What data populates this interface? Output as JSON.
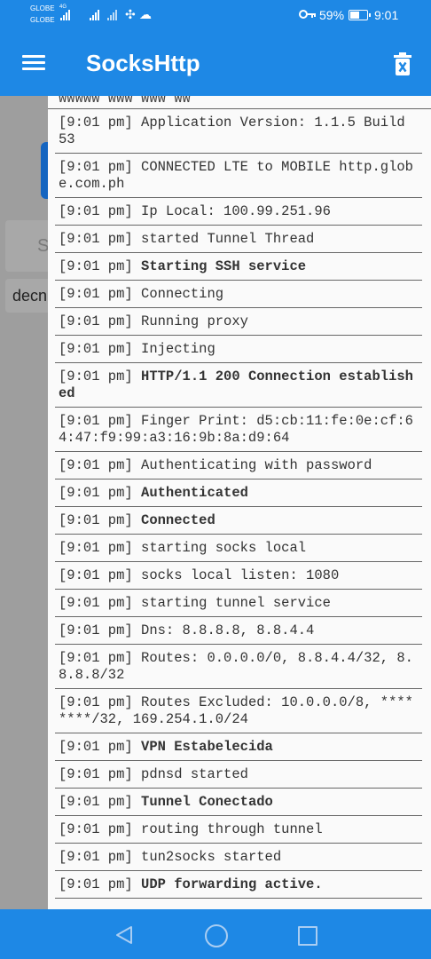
{
  "status_bar": {
    "carrier1": "GLOBE",
    "carrier2": "GLOBE",
    "network_type": "4G",
    "battery_percent": "59%",
    "battery_level": 0.59,
    "time": "9:01",
    "icons": [
      "signal-icon",
      "signal-icon",
      "signal-icon",
      "fan-icon",
      "cloud-icon",
      "key-icon",
      "battery-icon"
    ]
  },
  "toolbar": {
    "title": "SocksHttp",
    "menu_icon": "hamburger-icon",
    "clear_icon": "trash-icon"
  },
  "background": {
    "input_text": "S",
    "label_text": "decn"
  },
  "log": {
    "top_partial": "WWWWW WWW WWW WW",
    "entries": [
      {
        "time": "[9:01 pm]",
        "text": "Application Version: 1.1.5 Build 53",
        "bold": false,
        "lines": 2
      },
      {
        "time": "[9:01 pm]",
        "text": "CONNECTED LTE to MOBILE http.globe.com.ph",
        "bold": false,
        "lines": 2
      },
      {
        "time": "[9:01 pm]",
        "text": "Ip Local: 100.99.251.96",
        "bold": false,
        "lines": 1
      },
      {
        "time": "[9:01 pm]",
        "text": "started Tunnel Thread",
        "bold": false,
        "lines": 1
      },
      {
        "time": "[9:01 pm]",
        "text": "Starting SSH service",
        "bold": true,
        "lines": 1
      },
      {
        "time": "[9:01 pm]",
        "text": "Connecting",
        "bold": false,
        "lines": 1
      },
      {
        "time": "[9:01 pm]",
        "text": "Running proxy",
        "bold": false,
        "lines": 1
      },
      {
        "time": "[9:01 pm]",
        "text": "Injecting",
        "bold": false,
        "lines": 1
      },
      {
        "time": "[9:01 pm]",
        "text": "HTTP/1.1 200 Connection established",
        "bold": true,
        "lines": 2
      },
      {
        "time": "[9:01 pm]",
        "text": "Finger Print: d5:cb:11:fe:0e:cf:64:47:f9:99:a3:16:9b:8a:d9:64",
        "bold": false,
        "lines": 2
      },
      {
        "time": "[9:01 pm]",
        "text": "Authenticating with password",
        "bold": false,
        "lines": 1
      },
      {
        "time": "[9:01 pm]",
        "text": "Authenticated",
        "bold": true,
        "lines": 1
      },
      {
        "time": "[9:01 pm]",
        "text": "Connected",
        "bold": true,
        "lines": 1
      },
      {
        "time": "[9:01 pm]",
        "text": "starting socks local",
        "bold": false,
        "lines": 1
      },
      {
        "time": "[9:01 pm]",
        "text": "socks local listen: 1080",
        "bold": false,
        "lines": 1
      },
      {
        "time": "[9:01 pm]",
        "text": "starting tunnel service",
        "bold": false,
        "lines": 1
      },
      {
        "time": "[9:01 pm]",
        "text": "Dns: 8.8.8.8, 8.8.4.4",
        "bold": false,
        "lines": 1
      },
      {
        "time": "[9:01 pm]",
        "text": "Routes: 0.0.0.0/0, 8.8.4.4/32, 8.8.8.8/32",
        "bold": false,
        "lines": 2
      },
      {
        "time": "[9:01 pm]",
        "text": "Routes Excluded: 10.0.0.0/8, ********/32, 169.254.1.0/24",
        "bold": false,
        "lines": 2
      },
      {
        "time": "[9:01 pm]",
        "text": "VPN Estabelecida",
        "bold": true,
        "lines": 1
      },
      {
        "time": "[9:01 pm]",
        "text": "pdnsd started",
        "bold": false,
        "lines": 1
      },
      {
        "time": "[9:01 pm]",
        "text": "Tunnel Conectado",
        "bold": true,
        "lines": 1
      },
      {
        "time": "[9:01 pm]",
        "text": "routing through tunnel",
        "bold": false,
        "lines": 1
      },
      {
        "time": "[9:01 pm]",
        "text": "tun2socks started",
        "bold": false,
        "lines": 1
      },
      {
        "time": "[9:01 pm]",
        "text": "UDP forwarding active.",
        "bold": true,
        "lines": 1
      }
    ]
  },
  "colors": {
    "accent": "#1e88e5",
    "log_background": "#fafafa",
    "overlay": "#9e9e9e"
  }
}
